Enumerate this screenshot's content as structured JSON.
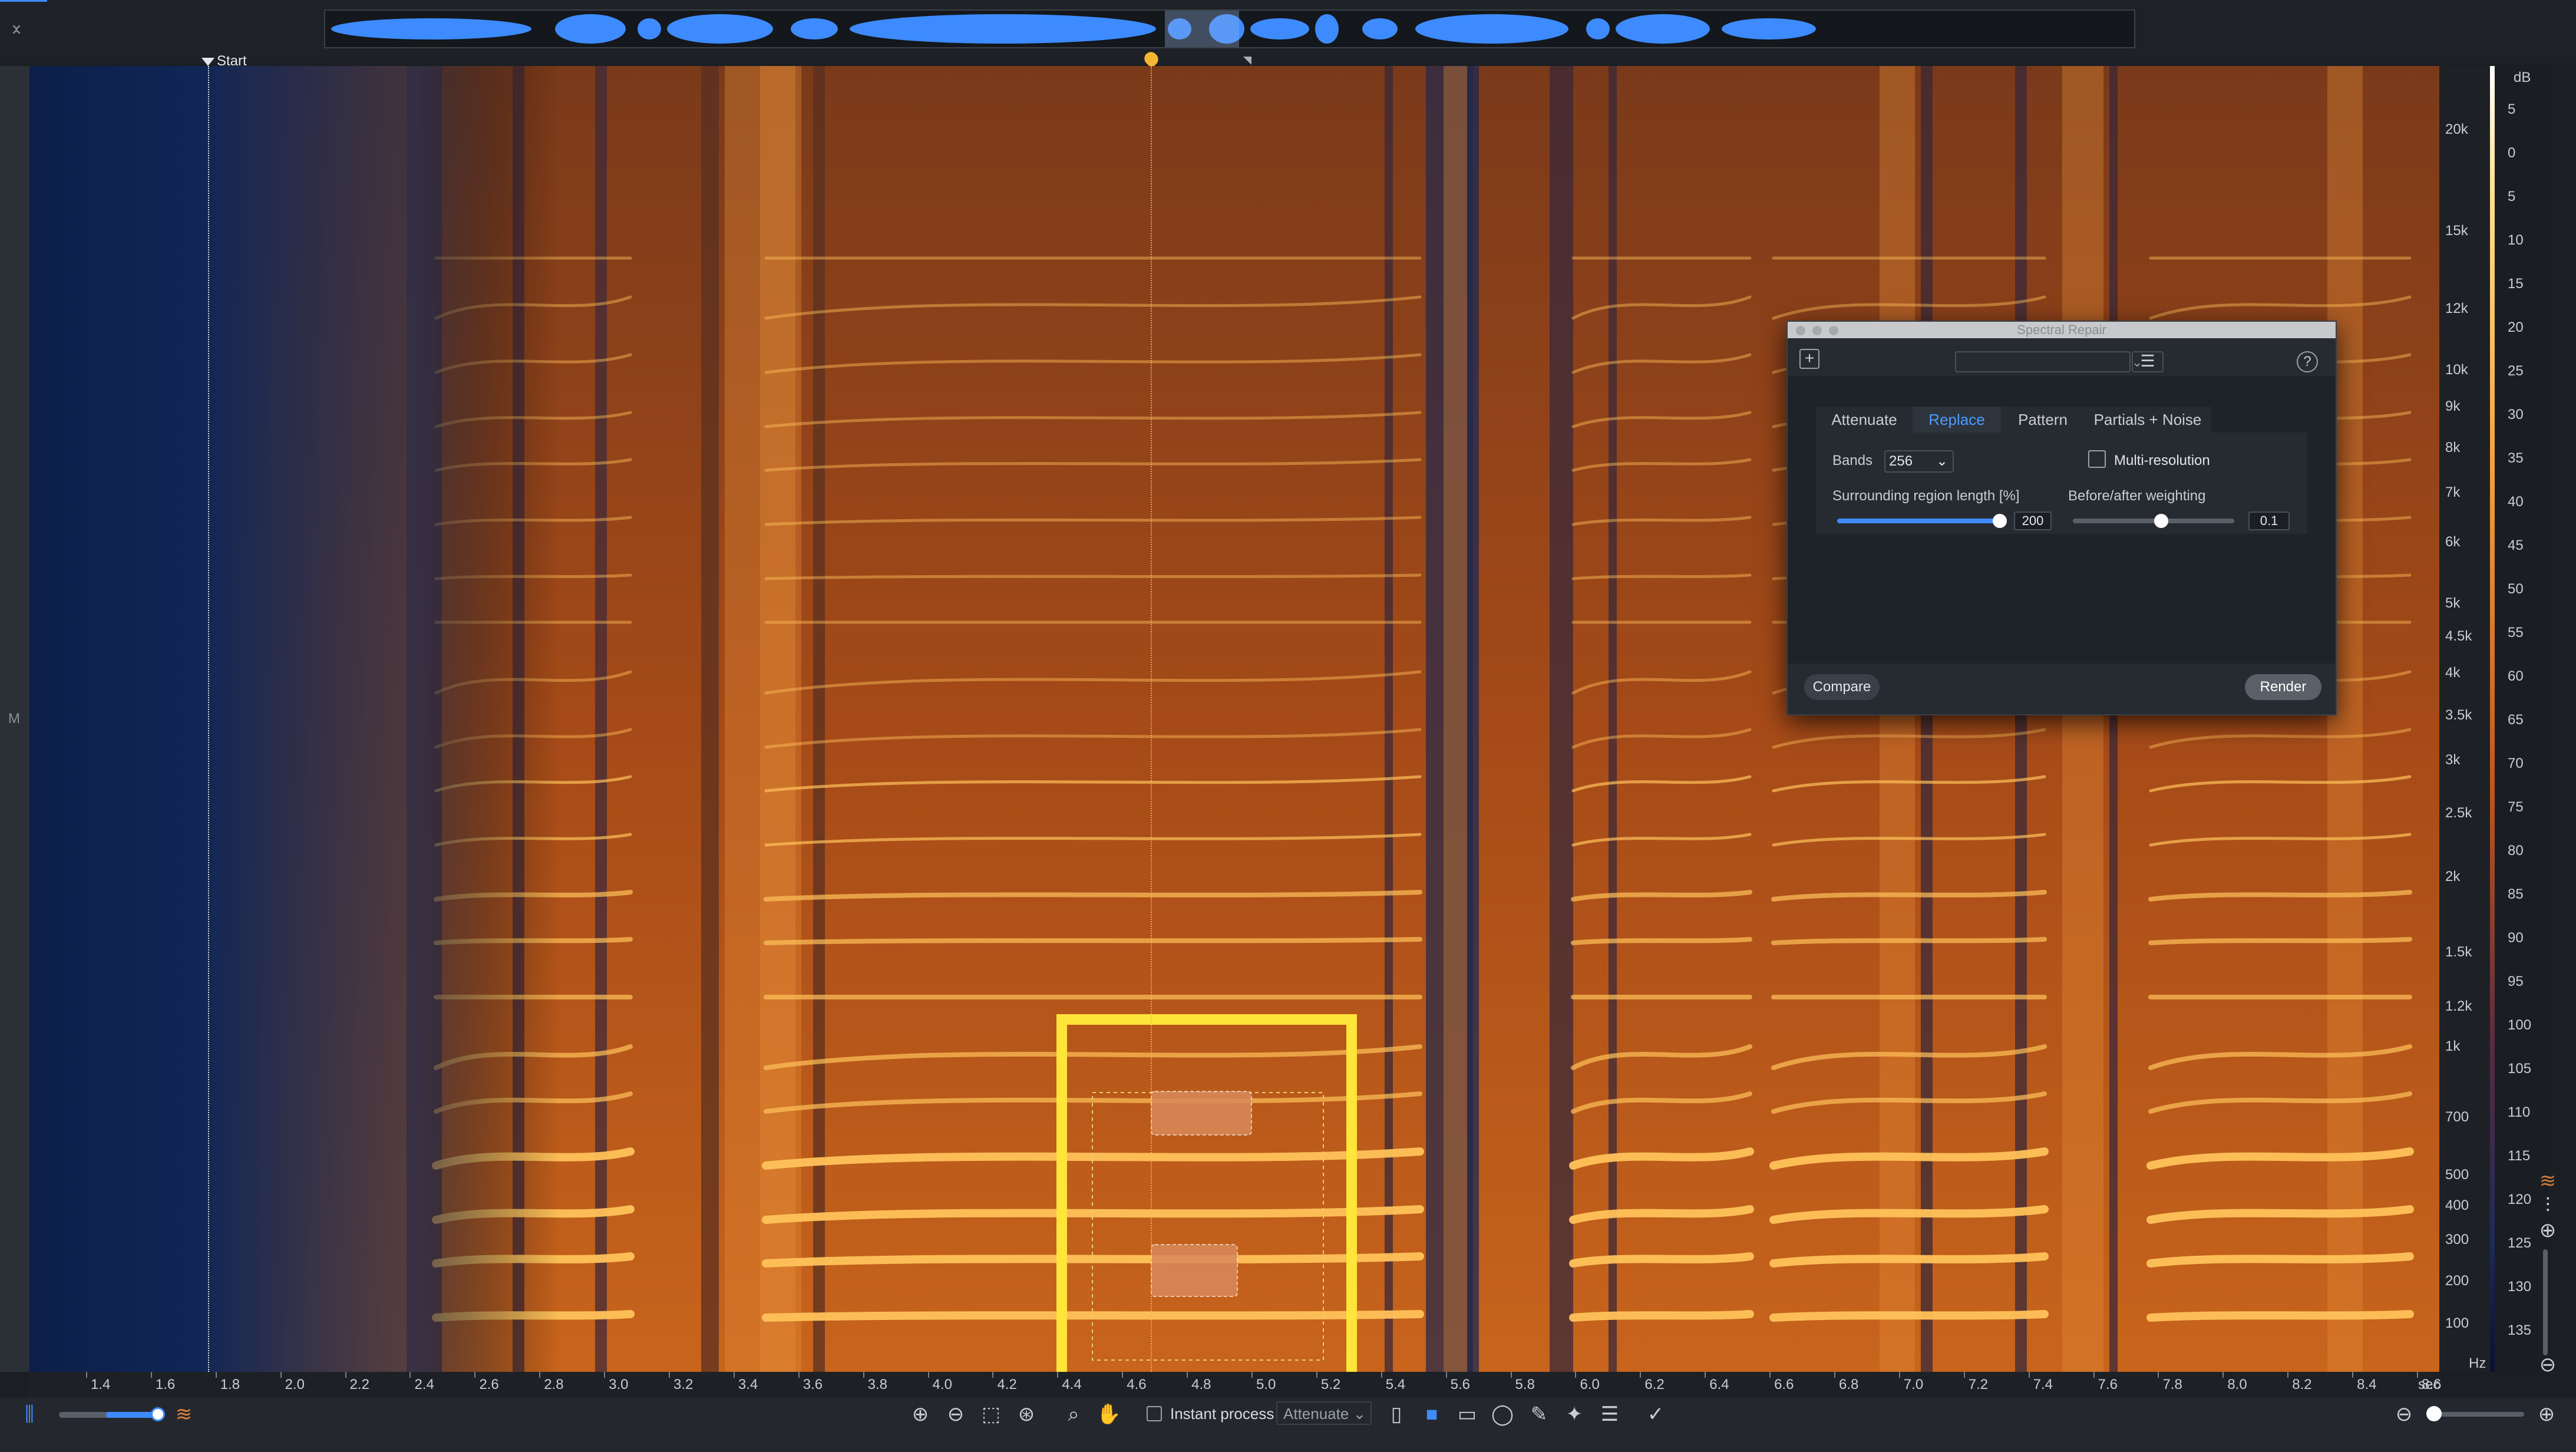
{
  "overview": {
    "name": "waveform-overview"
  },
  "markers": {
    "start_label": "Start"
  },
  "left_gutter": {
    "channel_label": "M"
  },
  "frequency_axis": {
    "unit": "Hz",
    "ticks": [
      "20k",
      "15k",
      "12k",
      "10k",
      "9k",
      "8k",
      "7k",
      "6k",
      "5k",
      "4.5k",
      "4k",
      "3.5k",
      "3k",
      "2.5k",
      "2k",
      "1.5k",
      "1.2k",
      "1k",
      "700",
      "500",
      "400",
      "300",
      "200",
      "100"
    ]
  },
  "db_axis": {
    "unit": "dB",
    "ticks": [
      "5",
      "0",
      "5",
      "10",
      "15",
      "20",
      "25",
      "30",
      "35",
      "40",
      "45",
      "50",
      "55",
      "60",
      "65",
      "70",
      "75",
      "80",
      "85",
      "90",
      "95",
      "100",
      "105",
      "110",
      "115",
      "120",
      "125",
      "130",
      "135"
    ]
  },
  "time_axis": {
    "unit": "sec",
    "ticks": [
      "1.4",
      "1.6",
      "1.8",
      "2.0",
      "2.2",
      "2.4",
      "2.6",
      "2.8",
      "3.0",
      "3.2",
      "3.4",
      "3.6",
      "3.8",
      "4.0",
      "4.2",
      "4.4",
      "4.6",
      "4.8",
      "5.0",
      "5.2",
      "5.4",
      "5.6",
      "5.8",
      "6.0",
      "6.2",
      "6.4",
      "6.6",
      "6.8",
      "7.0",
      "7.2",
      "7.4",
      "7.6",
      "7.8",
      "8.0",
      "8.2",
      "8.4",
      "8.6"
    ]
  },
  "toolbar": {
    "instant_process_label": "Instant process",
    "instant_process_checked": false,
    "mode_value": "Attenuate"
  },
  "dialog": {
    "title": "Spectral Repair",
    "tabs": [
      "Attenuate",
      "Replace",
      "Pattern",
      "Partials + Noise"
    ],
    "active_tab": "Replace",
    "bands_label": "Bands",
    "bands_value": "256",
    "multires_label": "Multi-resolution",
    "multires_checked": false,
    "surrounding_label": "Surrounding region length [%]",
    "surrounding_value": "200",
    "weighting_label": "Before/after weighting",
    "weighting_value": "0.1",
    "compare_label": "Compare",
    "render_label": "Render"
  },
  "colors": {
    "accent": "#3d8bff",
    "selection": "#ffe43a",
    "playhead": "#f5b731",
    "spectrogram_hot": "#ffb347",
    "spectrogram_cold": "#0c1f4a"
  },
  "icons": [
    "collapse-icon",
    "waveform-view-icon",
    "spectrogram-view-icon",
    "zoom-in-icon",
    "zoom-out-icon",
    "zoom-selection-icon",
    "zoom-fit-icon",
    "magnify-icon",
    "hand-icon",
    "time-select-icon",
    "rect-select-icon",
    "freq-select-icon",
    "lasso-icon",
    "brush-icon",
    "magic-wand-icon",
    "harmonic-select-icon",
    "pencil-icon",
    "vertical-zoom-in-icon",
    "vertical-zoom-out-icon"
  ]
}
